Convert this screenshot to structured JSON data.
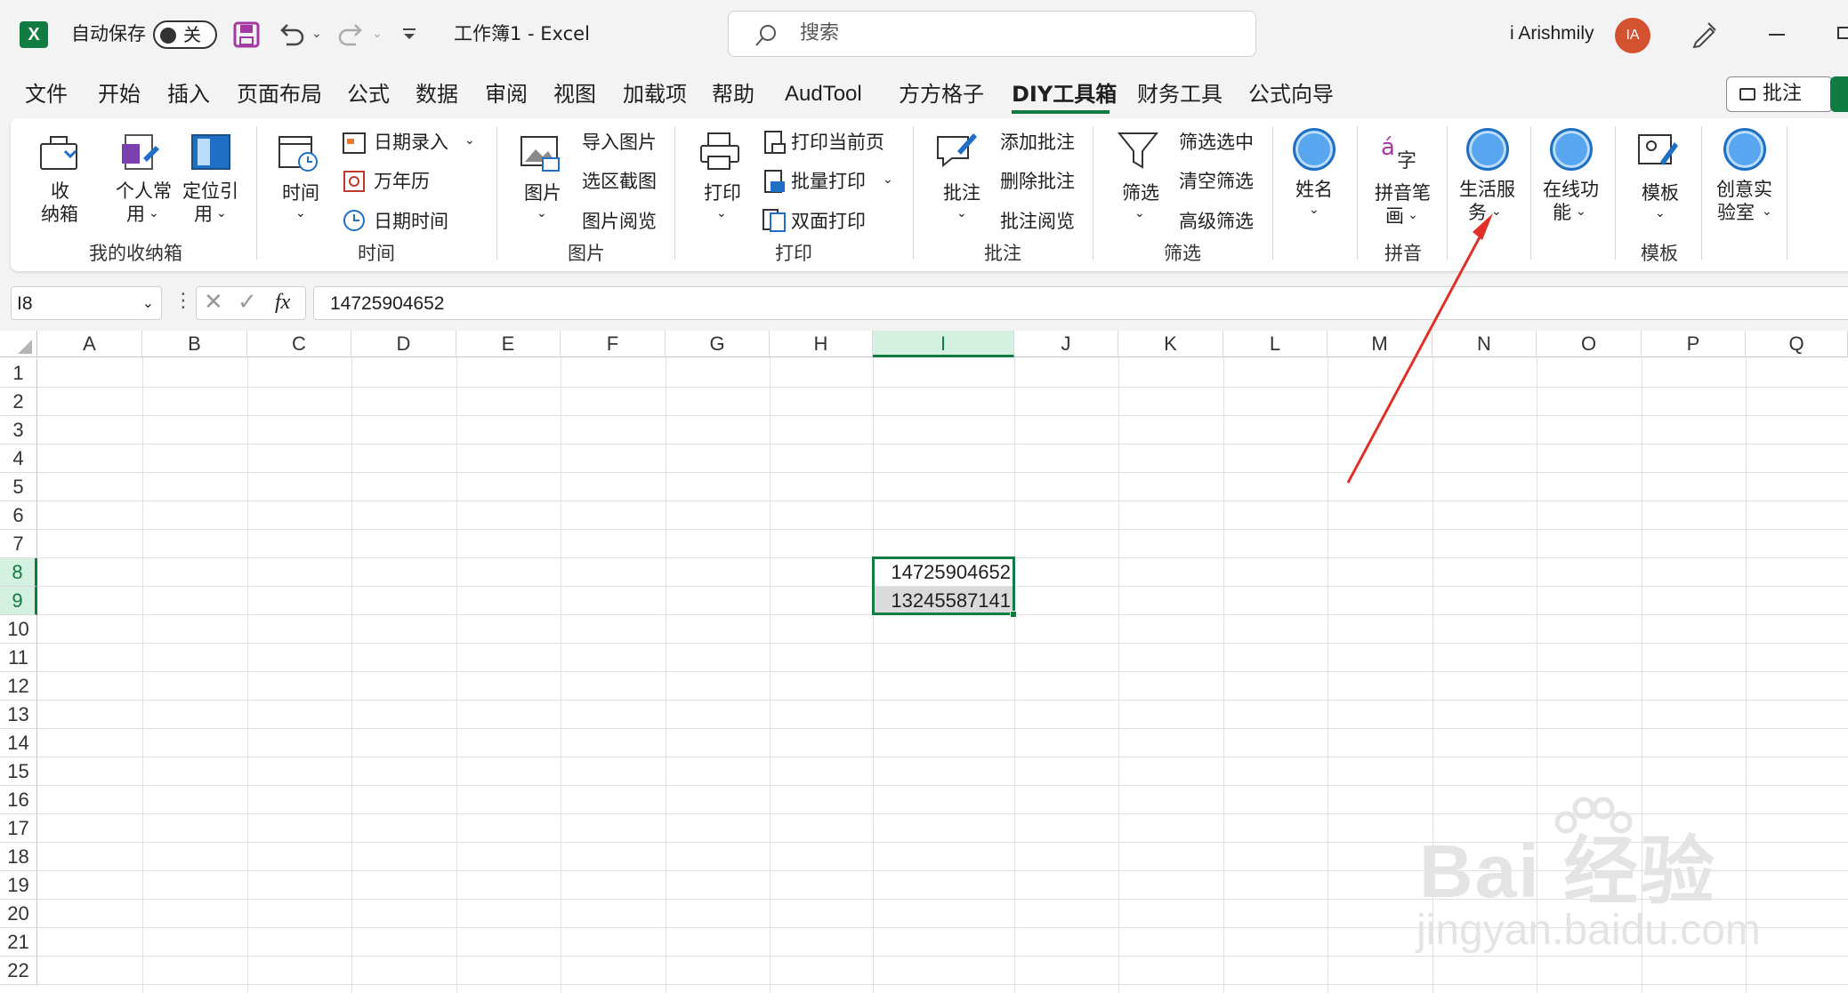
{
  "titlebar": {
    "autosave_label": "自动保存",
    "autosave_state": "关",
    "doc_title": "工作簿1  -  Excel",
    "search_placeholder": "搜索",
    "user_name": "i Arishmily",
    "avatar_initials": "IA",
    "brand_color": "#107c41"
  },
  "menu": {
    "items": [
      "文件",
      "开始",
      "插入",
      "页面布局",
      "公式",
      "数据",
      "审阅",
      "视图",
      "加载项",
      "帮助",
      "AudTool",
      "方方格子",
      "DIY工具箱",
      "财务工具",
      "公式向导"
    ],
    "active": "DIY工具箱",
    "comments_button": "批注"
  },
  "ribbon": {
    "g1": {
      "label": "我的收纳箱",
      "b1": "收",
      "b1b": "纳箱",
      "b2": "个人常",
      "b2b": "用",
      "b3": "定位引",
      "b3b": "用"
    },
    "g2": {
      "label": "时间",
      "big": "时间",
      "s1": "日期录入",
      "s2": "万年历",
      "s3": "日期时间"
    },
    "g3": {
      "label": "图片",
      "big": "图片",
      "s1": "导入图片",
      "s2": "选区截图",
      "s3": "图片阅览"
    },
    "g4": {
      "label": "打印",
      "big": "打印",
      "s1": "打印当前页",
      "s2": "批量打印",
      "s3": "双面打印"
    },
    "g5": {
      "label": "批注",
      "big": "批注",
      "s1": "添加批注",
      "s2": "删除批注",
      "s3": "批注阅览"
    },
    "g6": {
      "label": "筛选",
      "big": "筛选",
      "s1": "筛选选中",
      "s2": "清空筛选",
      "s3": "高级筛选"
    },
    "g7": {
      "big": "姓名"
    },
    "g8": {
      "label": "拼音",
      "big": "拼音笔",
      "bigb": "画"
    },
    "g9": {
      "big": "生活服",
      "bigb": "务"
    },
    "g10": {
      "big": "在线功",
      "bigb": "能"
    },
    "g11": {
      "label": "模板",
      "big": "模板"
    },
    "g12": {
      "big": "创意实",
      "bigb": "验室"
    }
  },
  "formula_bar": {
    "cell_ref": "I8",
    "value": "14725904652",
    "fx": "fx"
  },
  "sheet": {
    "columns": [
      "A",
      "B",
      "C",
      "D",
      "E",
      "F",
      "G",
      "H",
      "I",
      "J",
      "K",
      "L",
      "M",
      "N",
      "O",
      "P",
      "Q"
    ],
    "rows": [
      "1",
      "2",
      "3",
      "4",
      "5",
      "6",
      "7",
      "8",
      "9",
      "10",
      "11",
      "12",
      "13",
      "14",
      "15",
      "16",
      "17",
      "18",
      "19",
      "20",
      "21",
      "22"
    ],
    "selected_column": "I",
    "selected_rows": [
      "8",
      "9"
    ],
    "cells": {
      "I8": "14725904652",
      "I9": "13245587141"
    }
  },
  "watermark": {
    "line1": "Bai 经验",
    "line2": "jingyan.baidu.com"
  },
  "annotation": {
    "arrow_color": "#e0302a"
  }
}
